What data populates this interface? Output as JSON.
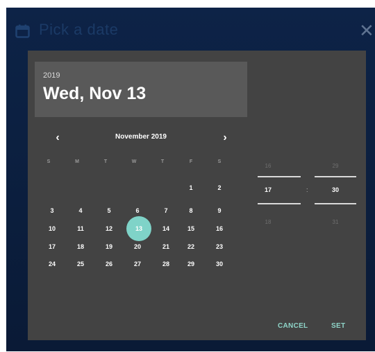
{
  "dialog": {
    "title": "Pick a date",
    "close_glyph": "✕",
    "icons": [
      "calendar-icon",
      "close-icon"
    ],
    "colors": {
      "accent": "#7fd3c8",
      "panel": "#434343",
      "header_box": "#595959"
    }
  },
  "selected": {
    "year": "2019",
    "date_label": "Wed, Nov 13"
  },
  "calendar": {
    "month_label": "November 2019",
    "prev_glyph": "‹",
    "next_glyph": "›",
    "weekdays": [
      "S",
      "M",
      "T",
      "W",
      "T",
      "F",
      "S"
    ],
    "weeks": [
      [
        "",
        "",
        "",
        "",
        "",
        "1",
        "2"
      ],
      [
        "3",
        "4",
        "5",
        "6",
        "7",
        "8",
        "9"
      ],
      [
        "10",
        "11",
        "12",
        "13",
        "14",
        "15",
        "16"
      ],
      [
        "17",
        "18",
        "19",
        "20",
        "21",
        "22",
        "23"
      ],
      [
        "24",
        "25",
        "26",
        "27",
        "28",
        "29",
        "30"
      ]
    ],
    "selected_day": "13"
  },
  "time": {
    "hour_prev": "16",
    "hour": "17",
    "hour_next": "18",
    "minute_prev": "29",
    "minute": "30",
    "minute_next": "31",
    "separator": ":"
  },
  "actions": {
    "cancel": "CANCEL",
    "set": "SET"
  }
}
